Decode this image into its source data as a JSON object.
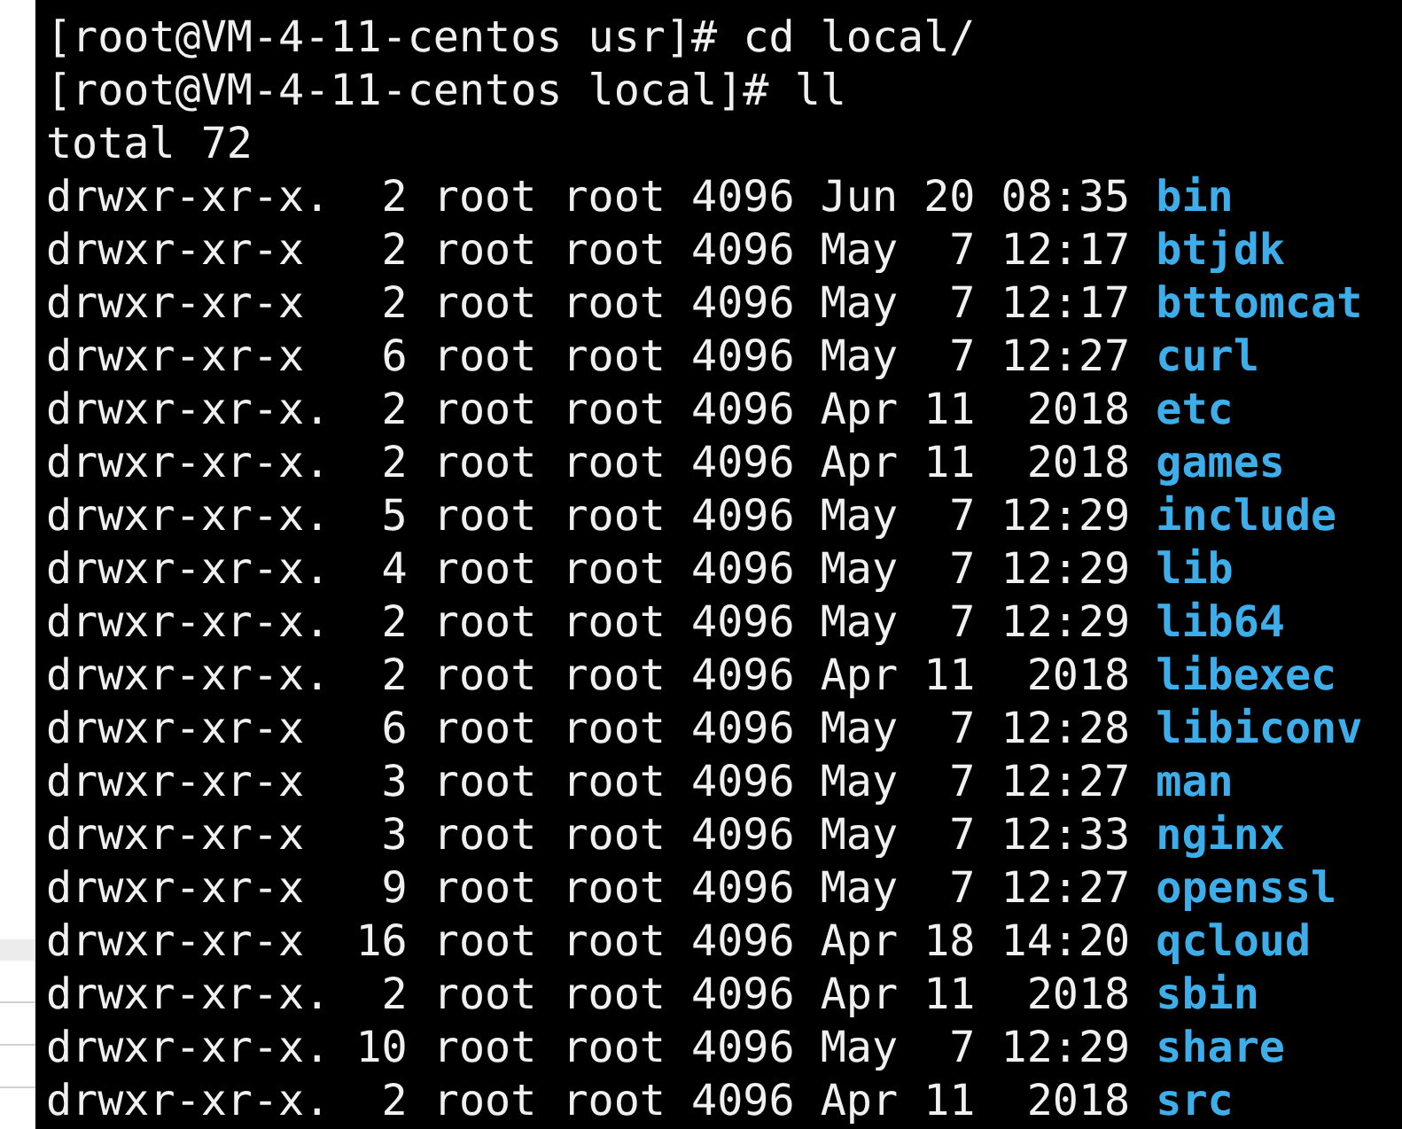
{
  "prompt_lines": [
    {
      "prompt": "[root@VM-4-11-centos usr]#",
      "command": "cd local/"
    },
    {
      "prompt": "[root@VM-4-11-centos local]#",
      "command": "ll"
    }
  ],
  "total": "total 72",
  "entries": [
    {
      "info": "drwxr-xr-x.  2 root root 4096 Jun 20 08:35",
      "name": "bin"
    },
    {
      "info": "drwxr-xr-x   2 root root 4096 May  7 12:17",
      "name": "btjdk"
    },
    {
      "info": "drwxr-xr-x   2 root root 4096 May  7 12:17",
      "name": "bttomcat"
    },
    {
      "info": "drwxr-xr-x   6 root root 4096 May  7 12:27",
      "name": "curl"
    },
    {
      "info": "drwxr-xr-x.  2 root root 4096 Apr 11  2018",
      "name": "etc"
    },
    {
      "info": "drwxr-xr-x.  2 root root 4096 Apr 11  2018",
      "name": "games"
    },
    {
      "info": "drwxr-xr-x.  5 root root 4096 May  7 12:29",
      "name": "include"
    },
    {
      "info": "drwxr-xr-x.  4 root root 4096 May  7 12:29",
      "name": "lib"
    },
    {
      "info": "drwxr-xr-x.  2 root root 4096 May  7 12:29",
      "name": "lib64"
    },
    {
      "info": "drwxr-xr-x.  2 root root 4096 Apr 11  2018",
      "name": "libexec"
    },
    {
      "info": "drwxr-xr-x   6 root root 4096 May  7 12:28",
      "name": "libiconv"
    },
    {
      "info": "drwxr-xr-x   3 root root 4096 May  7 12:27",
      "name": "man"
    },
    {
      "info": "drwxr-xr-x   3 root root 4096 May  7 12:33",
      "name": "nginx"
    },
    {
      "info": "drwxr-xr-x   9 root root 4096 May  7 12:27",
      "name": "openssl"
    },
    {
      "info": "drwxr-xr-x  16 root root 4096 Apr 18 14:20",
      "name": "qcloud"
    },
    {
      "info": "drwxr-xr-x.  2 root root 4096 Apr 11  2018",
      "name": "sbin"
    },
    {
      "info": "drwxr-xr-x. 10 root root 4096 May  7 12:29",
      "name": "share"
    },
    {
      "info": "drwxr-xr-x.  2 root root 4096 Apr 11  2018",
      "name": "src"
    }
  ]
}
